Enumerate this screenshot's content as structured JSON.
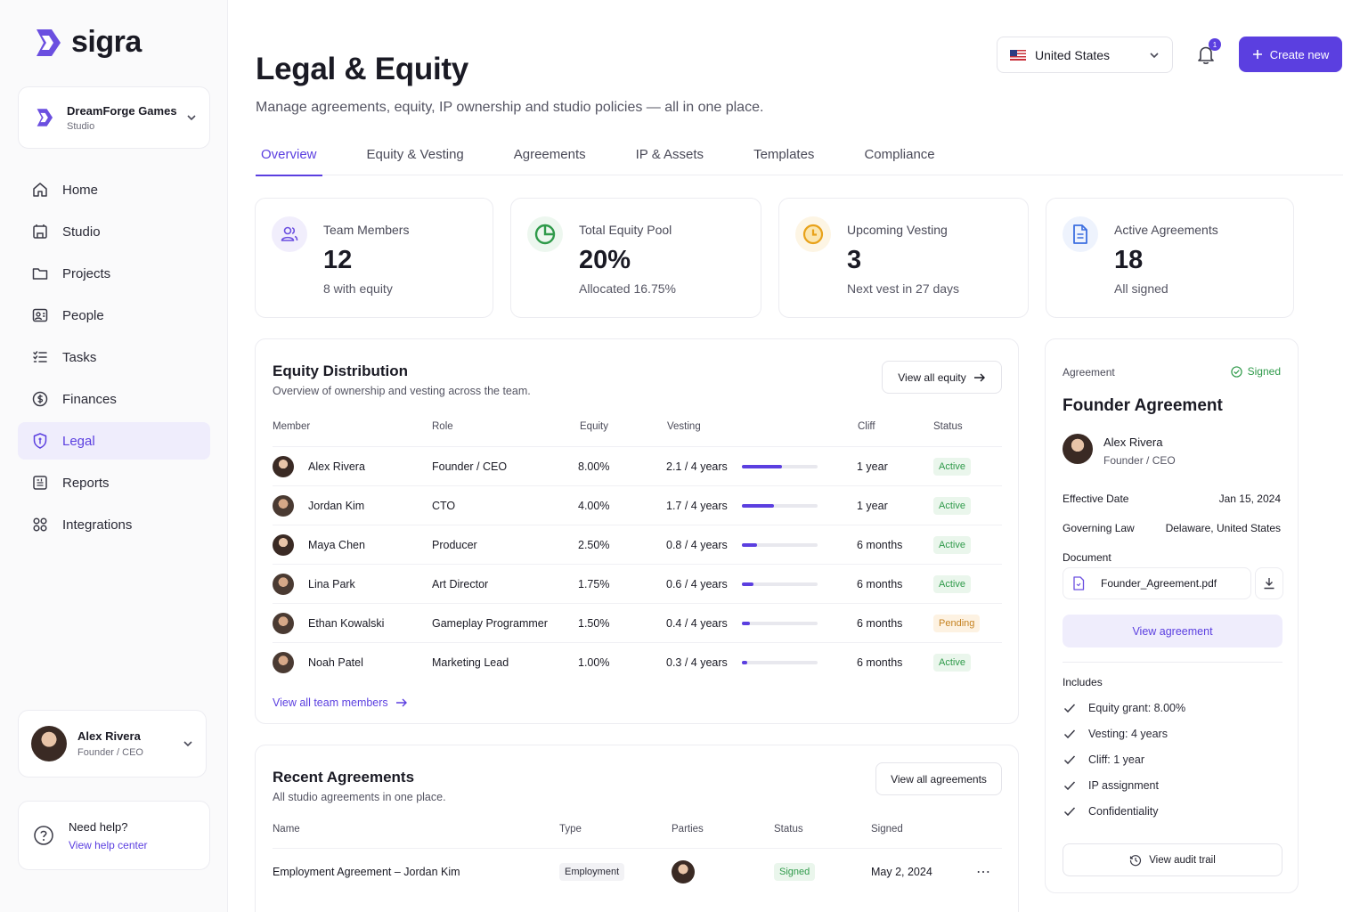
{
  "brand": {
    "name": "sigra"
  },
  "workspace": {
    "name": "DreamForge Games",
    "type": "Studio"
  },
  "nav": [
    {
      "label": "Home",
      "icon": "home-icon"
    },
    {
      "label": "Studio",
      "icon": "studio-icon"
    },
    {
      "label": "Projects",
      "icon": "folder-icon"
    },
    {
      "label": "People",
      "icon": "people-icon"
    },
    {
      "label": "Tasks",
      "icon": "list-icon"
    },
    {
      "label": "Finances",
      "icon": "finances-icon"
    },
    {
      "label": "Legal",
      "icon": "shield-icon",
      "active": true
    },
    {
      "label": "Reports",
      "icon": "reports-icon"
    },
    {
      "label": "Integrations",
      "icon": "integrations-icon"
    }
  ],
  "user": {
    "name": "Alex Rivera",
    "role": "Founder / CEO"
  },
  "help": {
    "title": "Need help?",
    "link": "View help center"
  },
  "header": {
    "title": "Legal & Equity",
    "subtitle": "Manage agreements, equity, IP ownership and studio policies — all in one place.",
    "country": "United States",
    "notifications": "1",
    "create_label": "Create new"
  },
  "tabs": [
    "Overview",
    "Equity & Vesting",
    "Agreements",
    "IP & Assets",
    "Templates",
    "Compliance"
  ],
  "stats": [
    {
      "label": "Team Members",
      "value": "12",
      "sub": "8 with equity",
      "color": "#6b4fe0"
    },
    {
      "label": "Total Equity Pool",
      "value": "20%",
      "sub": "Allocated 16.75%",
      "color": "#2f9a4a"
    },
    {
      "label": "Upcoming Vesting",
      "value": "3",
      "sub": "Next vest in 27 days",
      "color": "#e8a21a"
    },
    {
      "label": "Active Agreements",
      "value": "18",
      "sub": "All signed",
      "color": "#3d6fe0"
    }
  ],
  "equity": {
    "title": "Equity Distribution",
    "subtitle": "Overview of ownership and vesting across the team.",
    "view_all": "View all equity",
    "columns": [
      "Member",
      "Role",
      "Equity",
      "Vesting",
      "Cliff",
      "Status"
    ],
    "rows": [
      {
        "member": "Alex Rivera",
        "role": "Founder / CEO",
        "equity": "8.00%",
        "vesting": "2.1 / 4 years",
        "progress": 0.525,
        "cliff": "1 year",
        "status": "Active",
        "gender": "f"
      },
      {
        "member": "Jordan Kim",
        "role": "CTO",
        "equity": "4.00%",
        "vesting": "1.7 / 4 years",
        "progress": 0.425,
        "cliff": "1 year",
        "status": "Active",
        "gender": "m"
      },
      {
        "member": "Maya Chen",
        "role": "Producer",
        "equity": "2.50%",
        "vesting": "0.8 / 4 years",
        "progress": 0.2,
        "cliff": "6 months",
        "status": "Active",
        "gender": "f"
      },
      {
        "member": "Lina Park",
        "role": "Art Director",
        "equity": "1.75%",
        "vesting": "0.6 / 4 years",
        "progress": 0.15,
        "cliff": "6 months",
        "status": "Active",
        "gender": "m"
      },
      {
        "member": "Ethan Kowalski",
        "role": "Gameplay Programmer",
        "equity": "1.50%",
        "vesting": "0.4 / 4 years",
        "progress": 0.1,
        "cliff": "6 months",
        "status": "Pending",
        "gender": "m"
      },
      {
        "member": "Noah Patel",
        "role": "Marketing Lead",
        "equity": "1.00%",
        "vesting": "0.3 / 4 years",
        "progress": 0.075,
        "cliff": "6 months",
        "status": "Active",
        "gender": "m"
      }
    ],
    "view_members": "View all team members"
  },
  "recent": {
    "title": "Recent Agreements",
    "subtitle": "All studio agreements in one place.",
    "view_all": "View all agreements",
    "columns": [
      "Name",
      "Type",
      "Parties",
      "Status",
      "Signed"
    ],
    "rows": [
      {
        "name": "Employment Agreement – Jordan Kim",
        "type": "Employment",
        "status": "Signed",
        "signed": "May 2, 2024"
      }
    ]
  },
  "agreement": {
    "label": "Agreement",
    "status": "Signed",
    "title": "Founder Agreement",
    "person": "Alex Rivera",
    "person_role": "Founder / CEO",
    "effective_label": "Effective Date",
    "effective": "Jan 15, 2024",
    "law_label": "Governing Law",
    "law": "Delaware, United States",
    "doc_label": "Document",
    "doc_name": "Founder_Agreement.pdf",
    "view_label": "View agreement",
    "includes_label": "Includes",
    "includes": [
      "Equity grant: 8.00%",
      "Vesting: 4 years",
      "Cliff: 1 year",
      "IP assignment",
      "Confidentiality"
    ],
    "audit_label": "View audit trail"
  }
}
